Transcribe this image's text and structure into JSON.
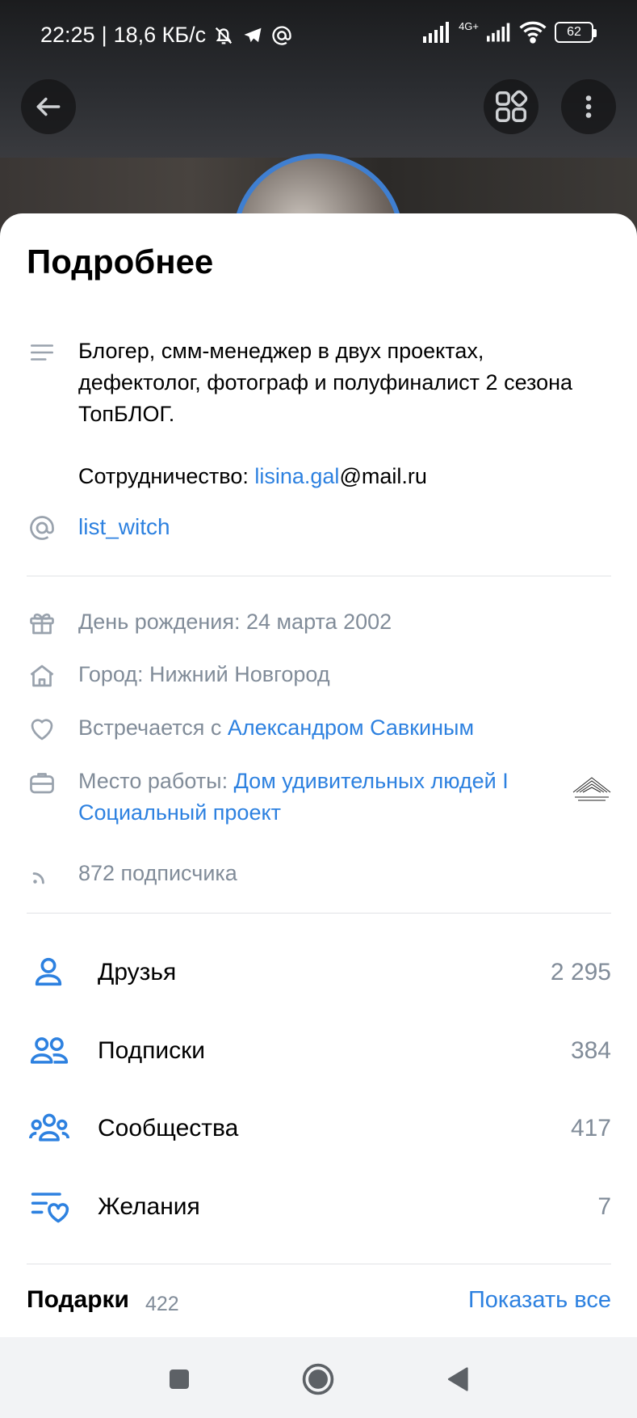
{
  "status_bar": {
    "time": "22:25",
    "separator": "|",
    "speed": "18,6 КБ/с",
    "network": "4G+",
    "battery": "62"
  },
  "header": {
    "back_icon": "arrow-left-icon",
    "apps_icon": "grid-icon",
    "more_icon": "more-vertical-icon"
  },
  "sheet": {
    "title": "Подробнее",
    "about": {
      "icon": "text-lines-icon",
      "text": "Блогер, смм-менеджер в двух проектах, дефектолог, фотограф и полуфиналист 2 сезона ТопБЛОГ.",
      "contact_prefix": "Сотрудничество: ",
      "contact_link": "lisina.gal",
      "contact_suffix": "@mail.ru"
    },
    "nickname": {
      "icon": "at-icon",
      "value": "list_witch"
    },
    "birthday": {
      "icon": "gift-icon",
      "text": "День рождения: 24 марта 2002"
    },
    "city": {
      "icon": "home-icon",
      "text": "Город: Нижний Новгород"
    },
    "relationship": {
      "icon": "heart-icon",
      "prefix": "Встречается с ",
      "link": "Александром Савкиным"
    },
    "work": {
      "icon": "briefcase-icon",
      "prefix": "Место работы: ",
      "link_line1": "Дом удивительных людей I",
      "link_line2": "Социальный проект"
    },
    "followers": {
      "icon": "rss-icon",
      "text": "872 подписчика"
    },
    "menu": [
      {
        "icon": "user-icon",
        "label": "Друзья",
        "count": "2 295"
      },
      {
        "icon": "users-icon",
        "label": "Подписки",
        "count": "384"
      },
      {
        "icon": "community-icon",
        "label": "Сообщества",
        "count": "417"
      },
      {
        "icon": "wishlist-icon",
        "label": "Желания",
        "count": "7"
      }
    ],
    "gifts": {
      "title": "Подарки",
      "count": "422",
      "show_all": "Показать все"
    }
  },
  "nav_bar": {
    "recents_icon": "square-icon",
    "home_icon": "circle-home-icon",
    "back_icon": "triangle-back-icon"
  },
  "colors": {
    "accent": "#2d81e0",
    "secondary_text": "#818c99",
    "divider": "#e1e3e6"
  }
}
